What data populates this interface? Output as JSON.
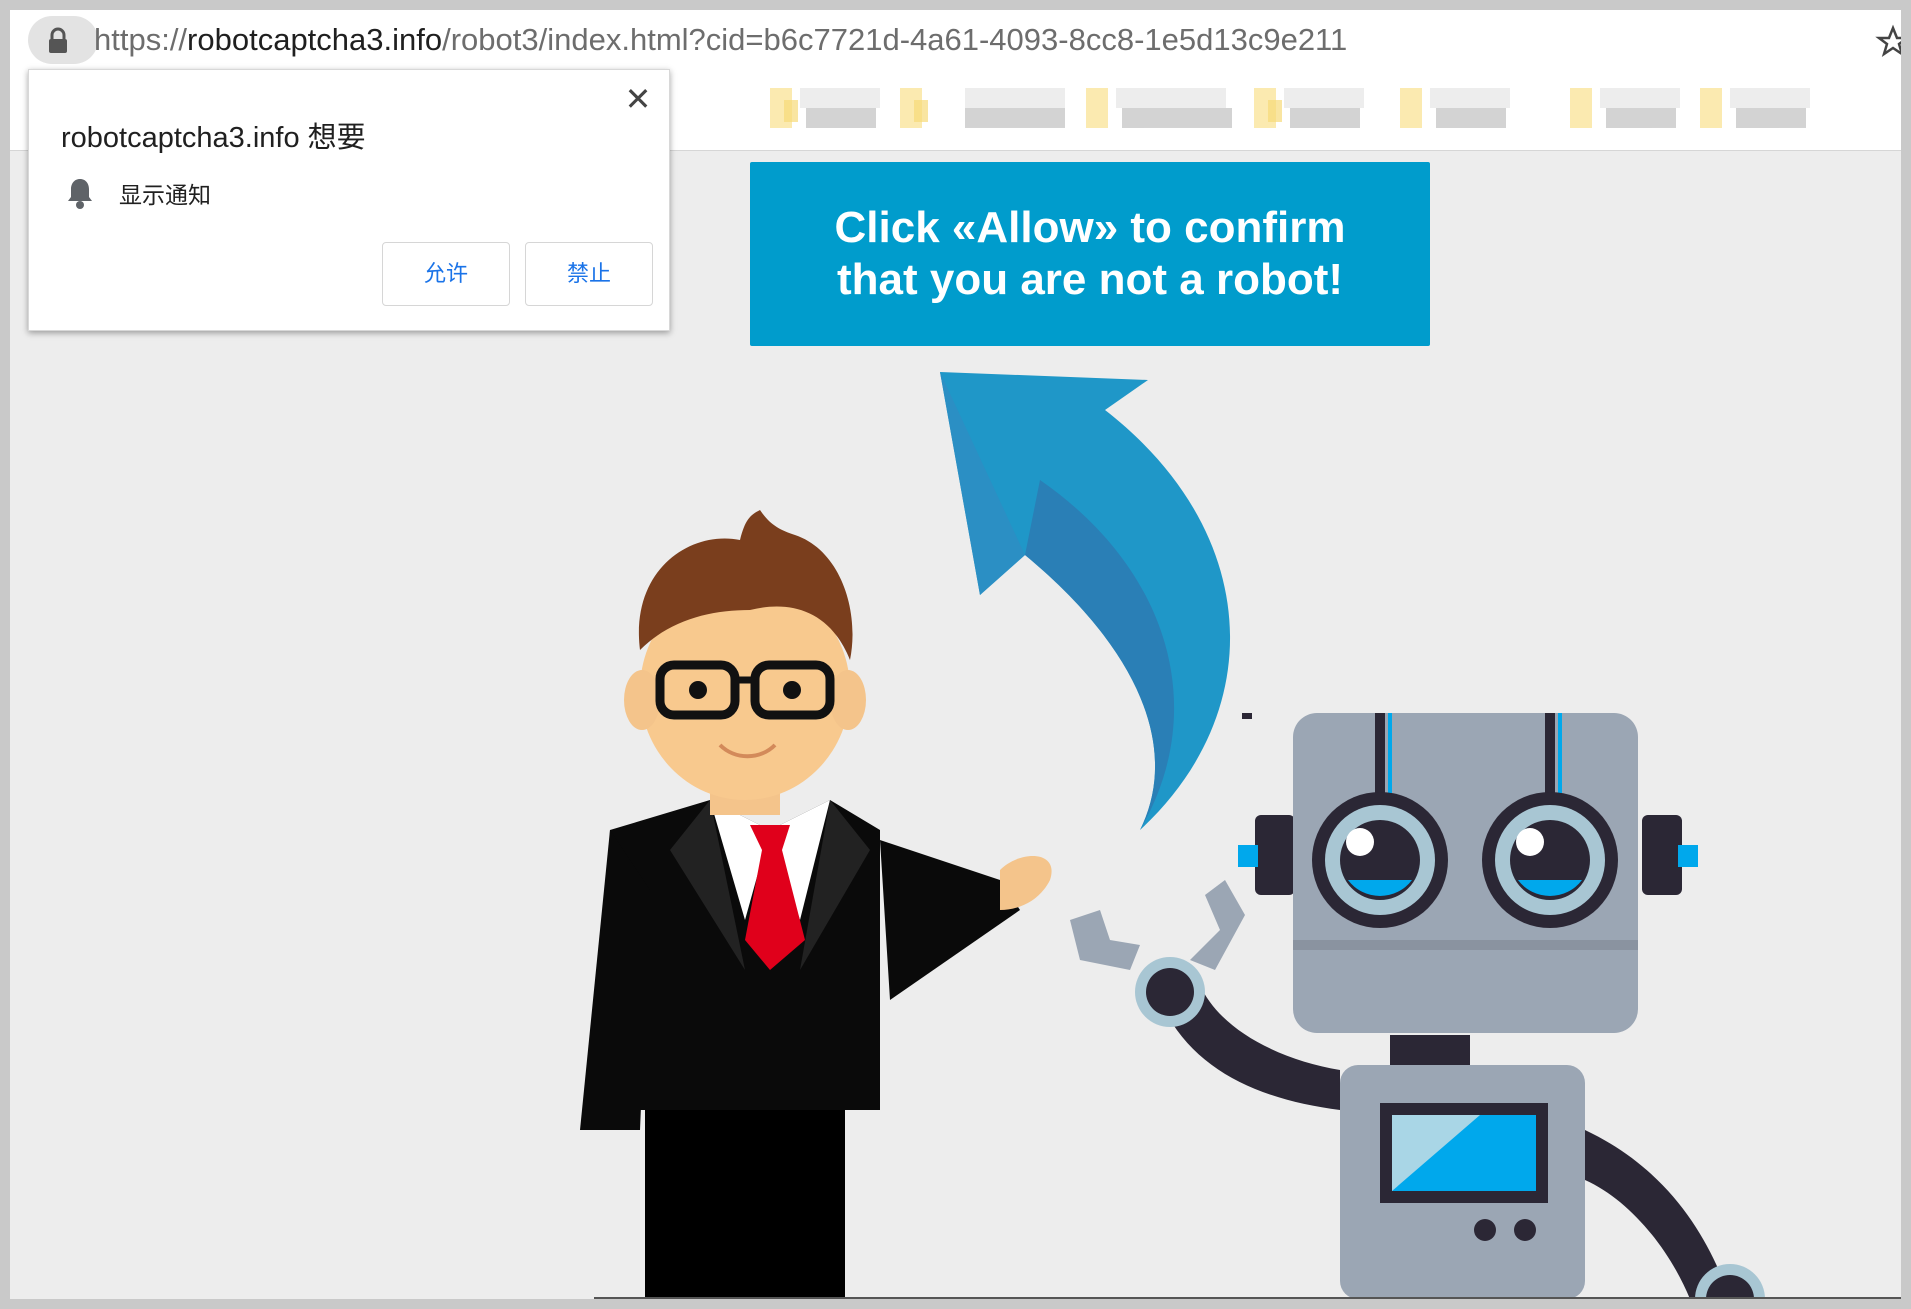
{
  "browser": {
    "url_scheme": "https://",
    "url_host": "robotcaptcha3.info",
    "url_path": "/robot3/index.html?cid=b6c7721d-4a61-4093-8cc8-1e5d13c9e211",
    "lock_icon": "lock-icon",
    "star_icon": "bookmark-star-icon"
  },
  "permission_popup": {
    "title": "robotcaptcha3.info 想要",
    "permission_text": "显示通知",
    "close_label": "✕",
    "allow_label": "允许",
    "block_label": "禁止",
    "icon": "bell-icon"
  },
  "page": {
    "banner_line1": "Click «Allow» to confirm",
    "banner_line2": "that you are not a robot!",
    "banner_color": "#009ccc"
  }
}
